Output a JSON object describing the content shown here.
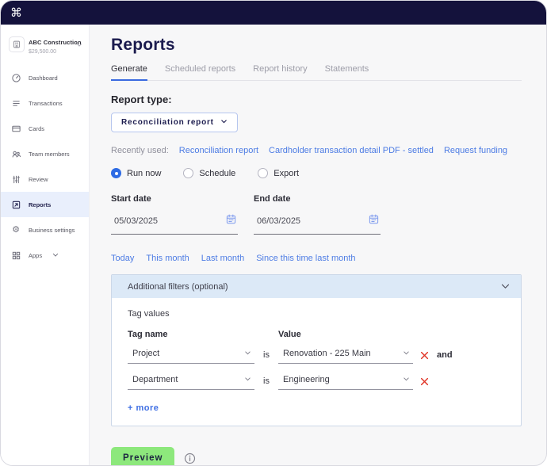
{
  "colors": {
    "topbar_navy": "#14123c",
    "accent_blue": "#2e6be4",
    "link_blue": "#4d7ce4",
    "tab_underline_blue": "#3a6ae0",
    "preview_green": "#8de87c",
    "danger_red": "#e03426",
    "filter_header_bg": "#dce9f7",
    "sidebar_active_bg": "#e9effc",
    "main_bg": "#f7f7f8"
  },
  "topbar": {
    "logo_icon": "command-icon",
    "logo_glyph": "⌘"
  },
  "sidebar": {
    "account": {
      "name": "ABC Construction",
      "balance": "$29,500.00"
    },
    "items": [
      {
        "label": "Dashboard",
        "icon": "dashboard-icon",
        "active": false
      },
      {
        "label": "Transactions",
        "icon": "transactions-icon",
        "active": false
      },
      {
        "label": "Cards",
        "icon": "cards-icon",
        "active": false
      },
      {
        "label": "Team members",
        "icon": "team-members-icon",
        "active": false
      },
      {
        "label": "Review",
        "icon": "review-sliders-icon",
        "active": false
      },
      {
        "label": "Reports",
        "icon": "reports-icon",
        "active": true
      },
      {
        "label": "Business settings",
        "icon": "gear-icon",
        "glyph": "⚙",
        "active": false
      },
      {
        "label": "Apps",
        "icon": "apps-grid-icon",
        "has_chevron": true,
        "active": false
      }
    ]
  },
  "main": {
    "title": "Reports",
    "tabs": [
      {
        "label": "Generate",
        "active": true
      },
      {
        "label": "Scheduled reports",
        "active": false
      },
      {
        "label": "Report history",
        "active": false
      },
      {
        "label": "Statements",
        "active": false
      }
    ],
    "report_type": {
      "heading": "Report type:",
      "selected": "Reconciliation report"
    },
    "recently_used": {
      "label": "Recently used:",
      "links": [
        "Reconciliation report",
        "Cardholder transaction detail PDF - settled",
        "Request funding"
      ]
    },
    "run_mode": {
      "options": [
        {
          "label": "Run now",
          "selected": true
        },
        {
          "label": "Schedule",
          "selected": false
        },
        {
          "label": "Export",
          "selected": false
        }
      ]
    },
    "dates": {
      "start": {
        "label": "Start date",
        "value": "05/03/2025"
      },
      "end": {
        "label": "End date",
        "value": "06/03/2025"
      }
    },
    "quick_ranges": [
      "Today",
      "This month",
      "Last month",
      "Since this time last month"
    ],
    "filters": {
      "header": "Additional filters (optional)",
      "section_label": "Tag values",
      "col_tag_name": "Tag name",
      "col_value": "Value",
      "rows": [
        {
          "tag_name": "Project",
          "operator": "is",
          "value": "Renovation - 225 Main",
          "connector": "and"
        },
        {
          "tag_name": "Department",
          "operator": "is",
          "value": "Engineering",
          "connector": ""
        }
      ],
      "more_link": "+ more"
    },
    "preview_button": "Preview"
  }
}
